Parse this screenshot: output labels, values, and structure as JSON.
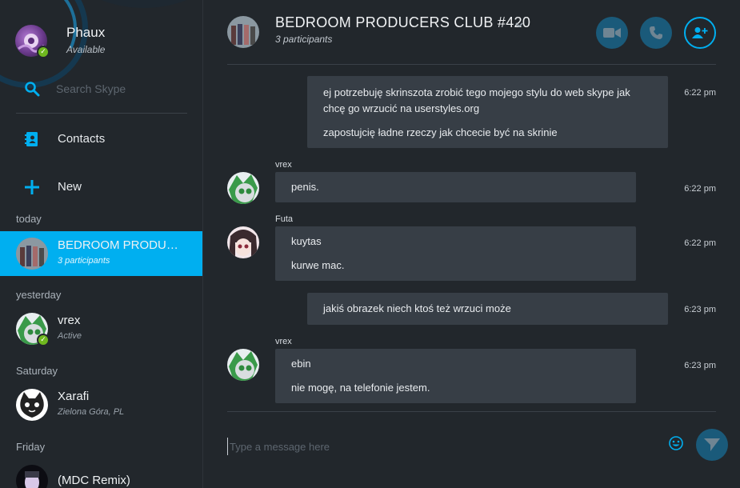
{
  "profile": {
    "name": "Phaux",
    "status": "Available",
    "status_color": "#6fb81f"
  },
  "search": {
    "placeholder": "Search Skype"
  },
  "nav": {
    "contacts_label": "Contacts",
    "new_label": "New"
  },
  "recents": {
    "groups": [
      {
        "label": "today"
      },
      {
        "label": "yesterday"
      },
      {
        "label": "Saturday"
      },
      {
        "label": "Friday"
      }
    ],
    "items": [
      {
        "name": "BEDROOM PRODUCERS CLUB #420",
        "sub": "3 participants"
      },
      {
        "name": "vrex",
        "sub": "Active"
      },
      {
        "name": "Xarafi",
        "sub": "Zielona Góra, PL"
      },
      {
        "name": "(MDC Remix)",
        "sub": ""
      }
    ]
  },
  "chat": {
    "title": "BEDROOM PRODUCERS CLUB #420",
    "participants": "3 participants",
    "accent_color": "#00aff0"
  },
  "messages": [
    {
      "sender": "",
      "time": "6:22 pm",
      "lines": [
        "ej potrzebuję skrinszota zrobić tego mojego stylu do web skype jak",
        "chcę go wrzucić na userstyles.org",
        "zapostujcię ładne rzeczy jak chcecie być na skrinie"
      ]
    },
    {
      "sender": "vrex",
      "time": "6:22 pm",
      "lines": [
        "penis."
      ]
    },
    {
      "sender": "Futa",
      "time": "6:22 pm",
      "lines": [
        "kuytas",
        "kurwe mac."
      ]
    },
    {
      "sender": "",
      "time": "6:23 pm",
      "lines": [
        "jakiś obrazek niech ktoś też wrzuci może"
      ]
    },
    {
      "sender": "vrex",
      "time": "6:23 pm",
      "lines": [
        "ebin",
        "nie mogę, na telefonie jestem."
      ]
    }
  ],
  "composer": {
    "placeholder": "Type a message here"
  },
  "icons": {
    "search": "search-icon",
    "contacts": "contacts-book-icon",
    "new": "plus-icon",
    "video": "video-camera-icon",
    "call": "phone-icon",
    "add_people": "add-person-icon",
    "emoji": "smiley-icon",
    "send": "send-plane-icon"
  }
}
